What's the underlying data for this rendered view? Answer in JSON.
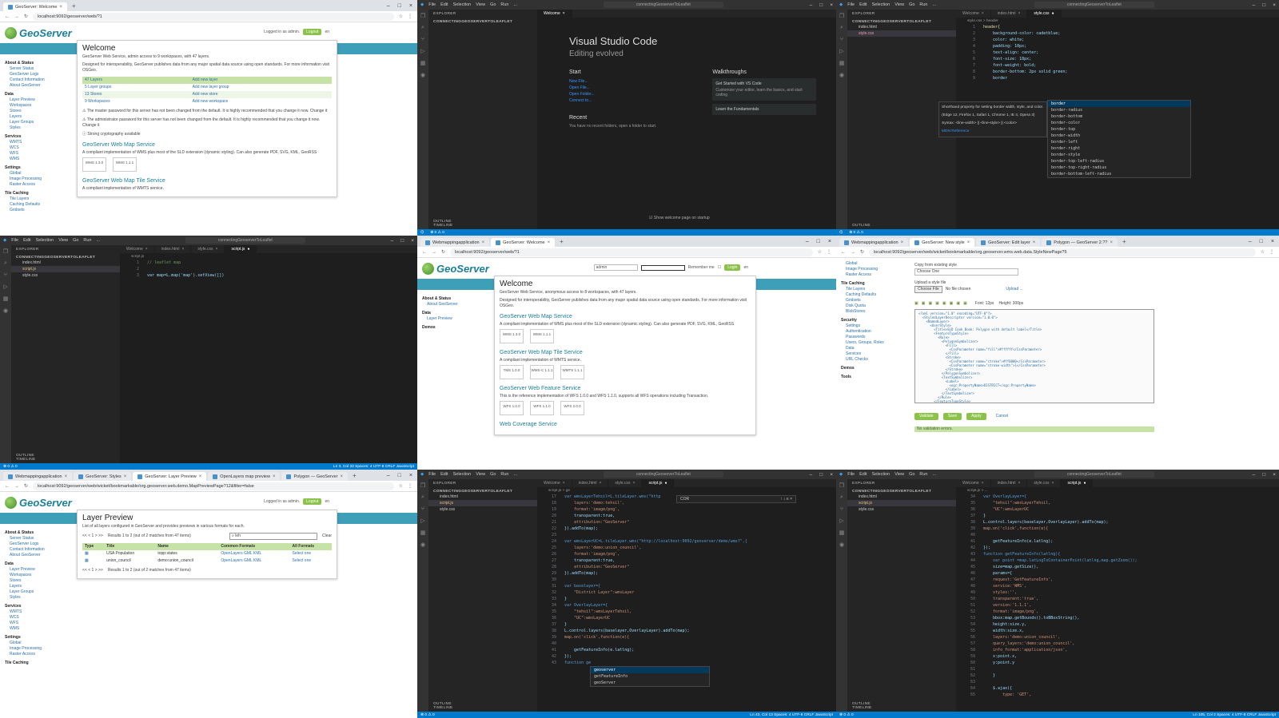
{
  "p1": {
    "tab_title": "GeoServer: Welcome",
    "url": "localhost:9092/geoserver/web/?1",
    "logo": "GeoServer",
    "logged_in": "Logged in as admin.",
    "logout": "Logout",
    "lang": "en",
    "sidebar": [
      {
        "h": "About & Status",
        "items": [
          "Server Status",
          "GeoServer Logs",
          "Contact Information",
          "About GeoServer"
        ]
      },
      {
        "h": "Data",
        "items": [
          "Layer Preview",
          "Workspaces",
          "Stores",
          "Layers",
          "Layer Groups",
          "Styles"
        ]
      },
      {
        "h": "Services",
        "items": [
          "WMTS",
          "WCS",
          "WFS",
          "WMS"
        ]
      },
      {
        "h": "Settings",
        "items": [
          "Global",
          "Image Processing",
          "Raster Access"
        ]
      },
      {
        "h": "Tile Caching",
        "items": [
          "Tile Layers",
          "Caching Defaults",
          "Gridsets"
        ]
      }
    ],
    "welcome": "Welcome",
    "intro": "GeoServer Web Service, admin access to 9 workspaces, with 47 layers.",
    "intro2": "Designed for interoperability, GeoServer publishes data from any major spatial data source using open standards. For more information visit OSGeo.",
    "table": [
      [
        "47 Layers",
        "Add new layer"
      ],
      [
        "5 Layer groups",
        "Add new layer group"
      ],
      [
        "13 Stores",
        "Add new store"
      ],
      [
        "9 Workspaces",
        "Add new workspace"
      ]
    ],
    "warn1": "The master password for this server has not been changed from the default. It is highly recommended that you change it now. Change it",
    "warn2": "The administrator password for this server has not been changed from the default. It is highly recommended that you change it now. Change it",
    "strong": "Strong cryptography available",
    "wms_h": "GeoServer Web Map Service",
    "wms_d": "A compliant implementation of WMS plus most of the SLD extension (dynamic styling). Can also generate PDF, SVG, KML, GeoRSS",
    "wms_boxes": [
      "WMS 1.3.0",
      "WMS 1.1.1"
    ],
    "wmts_h": "GeoServer Web Map Tile Service",
    "wmts_d": "A compliant implementation of WMTS service."
  },
  "p2": {
    "menu": [
      "File",
      "Edit",
      "Selection",
      "View",
      "Go",
      "Run",
      "..."
    ],
    "search": "connectingGeoserverToLeaflet",
    "explorer": "EXPLORER",
    "project": "CONNECTINGGEOSERVERTOLEAFLET",
    "tab": "Welcome",
    "title": "Visual Studio Code",
    "subtitle": "Editing evolved",
    "start": "Start",
    "start_items": [
      "New File...",
      "Open File...",
      "Open Folder...",
      "Connect to..."
    ],
    "recent": "Recent",
    "recent_text": "You have no recent folders, open a folder to start.",
    "walk": "Walkthroughs",
    "walk_items": [
      "Get Started with VS Code",
      "Learn the Fundamentals"
    ],
    "walk_desc": "Customize your editor, learn the basics, and start coding",
    "show": "Show welcome page on startup",
    "outline": "OUTLINE",
    "timeline": "TIMELINE"
  },
  "p3": {
    "menu": [
      "File",
      "Edit",
      "Selection",
      "View",
      "Go",
      "Run",
      "..."
    ],
    "search": "connectingGeoserverToLeaflet",
    "explorer": "EXPLORER",
    "project": "CONNECTINGGEOSERVERTOLEAFLET",
    "files": [
      "index.html",
      "style.css"
    ],
    "tabs": [
      "Welcome",
      "index.html",
      "style.css"
    ],
    "crumb": "style.css > header",
    "code": [
      "header{",
      "    background-color: cadetblue;",
      "    color: white;",
      "    padding: 10px;",
      "    text-align: center;",
      "    font-size: 18px;",
      "    font-weight: bold;",
      "    border-bottom: 2px solid green;",
      "    border"
    ],
    "hover_text": "Shorthand property for setting border width, style, and color.",
    "hover_compat": "(Edge 12, Firefox 1, Safari 1, Chrome 1, IE 4, Opera 3)",
    "hover_syntax": "Syntax: <line-width> || <line-style> || <color>",
    "hover_ref": "MDN Reference",
    "suggest": [
      "border",
      "border-radius",
      "border-bottom",
      "border-color",
      "border-top",
      "border-width",
      "border-left",
      "border-right",
      "border-style",
      "border-top-left-radius",
      "border-top-right-radius",
      "border-bottom-left-radius"
    ],
    "outline": "OUTLINE"
  },
  "p4": {
    "menu": [
      "File",
      "Edit",
      "Selection",
      "View",
      "Go",
      "Run",
      "..."
    ],
    "search": "connectingGeoserverToLeaflet",
    "explorer": "EXPLORER",
    "project": "CONNECTINGGEOSERVERTOLEAFLET",
    "files": [
      "index.html",
      "script.js",
      "style.css"
    ],
    "tabs": [
      "Welcome",
      "index.html",
      "style.css",
      "script.js"
    ],
    "crumb": "script.js",
    "code": [
      "// leaflet map",
      "",
      "var map=L.map('map').setView([])"
    ],
    "outline": "OUTLINE",
    "timeline": "TIMELINE",
    "status": "Ln 3, Col 33   Spaces: 4   UTF-8   CRLF   JavaScript"
  },
  "p5": {
    "tabs": [
      "Webmappingapplication",
      "GeoServer: Welcome"
    ],
    "url": "localhost:9092/geoserver/web/?1",
    "user": "admin",
    "remember": "Remember me",
    "login": "Login",
    "lang": "en",
    "sidebar": [
      {
        "h": "About & Status",
        "items": [
          "About GeoServer"
        ]
      },
      {
        "h": "Data",
        "items": [
          "Layer Preview"
        ]
      },
      {
        "h": "Demos",
        "items": []
      }
    ],
    "welcome": "Welcome",
    "intro": "GeoServer Web Service, anonymous access to 8 workspaces, with 47 layers.",
    "intro2": "Designed for interoperability, GeoServer publishes data from any major spatial data source using open standards. For more information visit OSGeo.",
    "wms_h": "GeoServer Web Map Service",
    "wms_d": "A compliant implementation of WMS plus most of the SLD extension (dynamic styling). Can also generate PDF, SVG, KML, GeoRSS",
    "wms_boxes": [
      "WMS 1.3.0",
      "WMS 1.1.1"
    ],
    "wmts_h": "GeoServer Web Map Tile Service",
    "wmts_d": "A compliant implementation of WMTS service.",
    "wmts_boxes": [
      "TMS 1.0.0",
      "WMS-C 1.1.1",
      "WMTS 1.1.1"
    ],
    "wfs_h": "GeoServer Web Feature Service",
    "wfs_d": "This is the reference implementation of WFS 1.0.0 and WFS 1.1.0, supports all WFS operations including Transaction.",
    "wfs_boxes": [
      "WFS 1.0.0",
      "WFS 1.1.0",
      "WFS 2.0.0"
    ],
    "wcs_h": "Web Coverage Service"
  },
  "p6": {
    "tabs": [
      "Webmappingapplication",
      "GeoServer: New style",
      "GeoServer: Edit layer",
      "Polygon — GeoServer 2.??"
    ],
    "url": "localhost:9092/geoserver/web/wicket/bookmarkable/org.geoserver.wms.web.data.StyleNewPage?5",
    "sidebar": [
      {
        "h": "",
        "items": [
          "Global",
          "Image Processing",
          "Raster Access"
        ]
      },
      {
        "h": "Tile Caching",
        "items": [
          "Tile Layers",
          "Caching Defaults",
          "Gridsets",
          "Disk Quota",
          "BlobStores"
        ]
      },
      {
        "h": "Security",
        "items": [
          "Settings",
          "Authentication",
          "Passwords",
          "Users, Groups, Roles",
          "Data",
          "Services",
          "URL Checks"
        ]
      },
      {
        "h": "Demos",
        "items": []
      },
      {
        "h": "Tools",
        "items": []
      }
    ],
    "copy_label": "Copy from existing style",
    "choose": "Choose One",
    "upload_label": "Upload a style file",
    "choose_file": "Choose File",
    "no_file": "No file chosen",
    "upload": "Upload ...",
    "font": "Font: 12px",
    "height": "Height: 300px",
    "buttons": [
      "Validate",
      "Save",
      "Apply",
      "Cancel"
    ],
    "ok": "No validation errors."
  },
  "p7": {
    "tabs": [
      "Webmappingapplication",
      "GeoServer: Styles",
      "GeoServer: Layer Preview",
      "OpenLayers map preview",
      "Polygon — GeoServer"
    ],
    "url": "localhost:9092/geoserver/web/wicket/bookmarkable/org.geoserver.web.demo.MapPreviewPage?12&filter=false",
    "logo": "GeoServer",
    "logged_in": "Logged in as admin.",
    "logout": "Logout",
    "lang": "en",
    "sidebar": [
      {
        "h": "About & Status",
        "items": [
          "Server Status",
          "GeoServer Logs",
          "Contact Information",
          "About GeoServer"
        ]
      },
      {
        "h": "Data",
        "items": [
          "Layer Preview",
          "Workspaces",
          "Stores",
          "Layers",
          "Layer Groups",
          "Styles"
        ]
      },
      {
        "h": "Services",
        "items": [
          "WMTS",
          "WCS",
          "WFS",
          "WMS"
        ]
      },
      {
        "h": "Settings",
        "items": [
          "Global",
          "Image Processing",
          "Raster Access"
        ]
      },
      {
        "h": "Tile Caching",
        "items": []
      }
    ],
    "title": "Layer Preview",
    "desc": "List of all layers configured in GeoServer and provides previews in various formats for each.",
    "results": "Results 1 to 2 (out of 2 matches from 47 items)",
    "search": "leh",
    "clear": "Clear",
    "headers": [
      "Type",
      "Title",
      "Name",
      "Common Formats",
      "All Formats"
    ],
    "rows": [
      [
        "USA Population",
        "topp:states",
        "OpenLayers  GML  KML",
        "Select one"
      ],
      [
        "union_council",
        "demo:union_council",
        "OpenLayers  GML  KML",
        "Select one"
      ]
    ]
  },
  "p8": {
    "menu": [
      "File",
      "Edit",
      "Selection",
      "View",
      "Go",
      "Run",
      "..."
    ],
    "search": "connectingGeoserverToLeaflet",
    "explorer": "EXPLORER",
    "project": "CONNECTINGGEOSERVERTOLEAFLET",
    "files": [
      "index.html",
      "script.js",
      "style.css"
    ],
    "tabs": [
      "Welcome",
      "index.html",
      "style.css",
      "script.js"
    ],
    "crumb": "script.js > ge",
    "find": "COR",
    "code": [
      [
        "17",
        "var wmsLayerTehsil=L.tileLayer.wms(\"http"
      ],
      [
        "18",
        "    layers:'demo:tehsil',"
      ],
      [
        "19",
        "    format:'image/png',"
      ],
      [
        "20",
        "    transparent:true,"
      ],
      [
        "21",
        "    attribution:\"GeoServer\""
      ],
      [
        "22",
        "}).addTo(map);"
      ],
      [
        "23",
        ""
      ],
      [
        "24",
        "var wmsLayerUC=L.tileLayer.wms(\"http://localhost:9092/geoserver/demo/wms?\",{"
      ],
      [
        "25",
        "    layers:'demo:union_council',"
      ],
      [
        "26",
        "    format:'image/png',"
      ],
      [
        "27",
        "    transparent:true,"
      ],
      [
        "28",
        "    attribution:\"GeoServer\""
      ],
      [
        "29",
        "}).addTo(map);"
      ],
      [
        "30",
        ""
      ],
      [
        "31",
        "var baselayer={"
      ],
      [
        "32",
        "    \"District Layer\":wmsLayer"
      ],
      [
        "33",
        "}"
      ],
      [
        "34",
        "var OverlayLayer={"
      ],
      [
        "35",
        "    \"tehsil\":wmsLayerTehsil,"
      ],
      [
        "36",
        "    \"UC\":wmsLayerUC"
      ],
      [
        "37",
        "}"
      ],
      [
        "38",
        "L.control.layers(baselayer,OverlayLayer).addTo(map);"
      ],
      [
        "39",
        "map.on('click',function(e){"
      ],
      [
        "40",
        ""
      ],
      [
        "41",
        "    getFeatureInfo(e.latlng);"
      ],
      [
        "42",
        "});"
      ],
      [
        "43",
        "function ge"
      ]
    ],
    "suggest": [
      "geoserver",
      "getFeatureInfo",
      "geoServer"
    ],
    "outline": "OUTLINE",
    "timeline": "TIMELINE",
    "status": "Ln 43, Col 13   Spaces: 4   UTF-8   CRLF   JavaScript"
  },
  "p9": {
    "menu": [
      "File",
      "Edit",
      "Selection",
      "View",
      "Go",
      "Run",
      "..."
    ],
    "search": "connectingGeoserverToLeaflet",
    "explorer": "EXPLORER",
    "project": "CONNECTINGGEOSERVERTOLEAFLET",
    "files": [
      "index.html",
      "script.js",
      "style.css"
    ],
    "tabs": [
      "Welcome",
      "index.html",
      "style.css",
      "script.js"
    ],
    "crumb": "script.js > ...",
    "code": [
      [
        "34",
        "var OverlayLayer={"
      ],
      [
        "35",
        "    \"tehsil\":wmsLayerTehsil,"
      ],
      [
        "36",
        "    \"UC\":wmsLayerUC"
      ],
      [
        "37",
        "}"
      ],
      [
        "38",
        "L.control.layers(baselayer,OverlayLayer).addTo(map);"
      ],
      [
        "39",
        "map.on('click',function(e){"
      ],
      [
        "40",
        ""
      ],
      [
        "41",
        "    getFeatureInfo(e.latlng);"
      ],
      [
        "42",
        "});"
      ],
      [
        "43",
        "function getFeatureInfo(latlng){"
      ],
      [
        "44",
        "    var point =map.latLngToContainerPoint(latlng,map.getZoom());"
      ],
      [
        "45",
        "    size=map.getSize(),"
      ],
      [
        "46",
        "    params={"
      ],
      [
        "47",
        "    request:'GetFeatureInfo',"
      ],
      [
        "48",
        "    service:'WMS',"
      ],
      [
        "49",
        "    styles:'',"
      ],
      [
        "50",
        "    transparent:'true',"
      ],
      [
        "51",
        "    version:'1.1.1',"
      ],
      [
        "52",
        "    format:'image/png',"
      ],
      [
        "53",
        "    bbox:map.getBounds().toBBoxString(),"
      ],
      [
        "54",
        "    height:size.y,"
      ],
      [
        "55",
        "    width:size.x,"
      ],
      [
        "56",
        "    layers:'demo:union_council',"
      ],
      [
        "57",
        "    query_layers:'demo:union_council',"
      ],
      [
        "58",
        "    info_format:'application/json',"
      ],
      [
        "59",
        "    x:point.x,"
      ],
      [
        "60",
        "    y:point.y"
      ],
      [
        "61",
        ""
      ],
      [
        "62",
        "    }"
      ],
      [
        "63",
        ""
      ],
      [
        "64",
        "    $.ajax({"
      ],
      [
        "65",
        "        type: 'GET',"
      ]
    ],
    "outline": "OUTLINE",
    "timeline": "TIMELINE",
    "status": "Ln 105, Col 2   Spaces: 4   UTF-8   CRLF   JavaScript"
  }
}
